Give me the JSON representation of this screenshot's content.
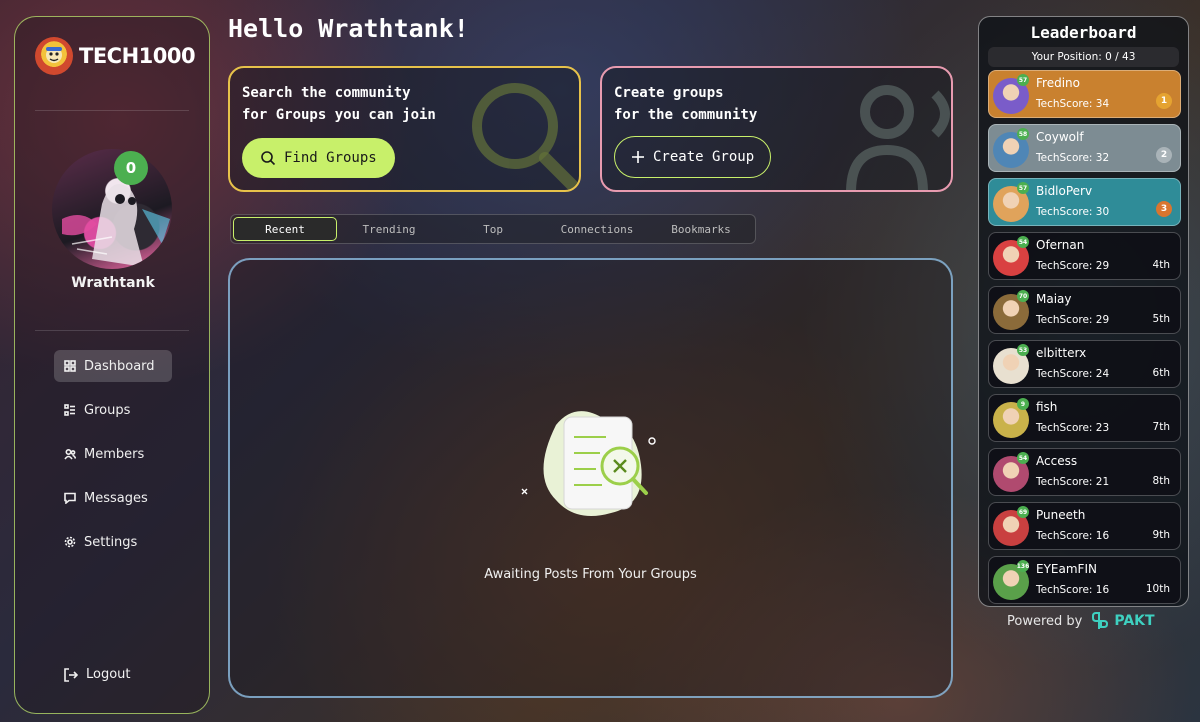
{
  "brand": {
    "name": "TECH1000"
  },
  "user": {
    "name": "Wrathtank",
    "level": "0"
  },
  "greeting": "Hello Wrathtank!",
  "nav": {
    "items": [
      {
        "label": "Dashboard",
        "icon": "dashboard-icon",
        "active": true
      },
      {
        "label": "Groups",
        "icon": "groups-icon"
      },
      {
        "label": "Members",
        "icon": "members-icon"
      },
      {
        "label": "Messages",
        "icon": "messages-icon"
      },
      {
        "label": "Settings",
        "icon": "settings-icon"
      }
    ],
    "logout": "Logout"
  },
  "cards": {
    "search": {
      "text": "Search the community\nfor Groups you can join",
      "button": "Find Groups",
      "color": "#e7c24a"
    },
    "create": {
      "text": "Create groups\nfor the community",
      "button": "Create Group",
      "color": "#e89bb0"
    }
  },
  "tabs": [
    "Recent",
    "Trending",
    "Top",
    "Connections",
    "Bookmarks"
  ],
  "feed": {
    "empty_text": "Awaiting Posts From Your Groups"
  },
  "leaderboard": {
    "title": "Leaderboard",
    "position": "Your Position: 0 / 43",
    "score_label": "TechScore:",
    "entries": [
      {
        "name": "Fredino",
        "score": "TechScore: 34",
        "rank": "1",
        "level": "57",
        "bg": "#c9812f",
        "medal": "#e5a331"
      },
      {
        "name": "Coywolf",
        "score": "TechScore: 32",
        "rank": "2",
        "level": "58",
        "bg": "#7d8c93",
        "medal": "#a9b3b8"
      },
      {
        "name": "BidloPerv",
        "score": "TechScore: 30",
        "rank": "3",
        "level": "57",
        "bg": "#2f8c98",
        "medal": "#d9752f"
      },
      {
        "name": "Ofernan",
        "score": "TechScore: 29",
        "rank": "4th",
        "level": "54"
      },
      {
        "name": "Maiay",
        "score": "TechScore: 29",
        "rank": "5th",
        "level": "70"
      },
      {
        "name": "elbitterx",
        "score": "TechScore: 24",
        "rank": "6th",
        "level": "53"
      },
      {
        "name": "fish",
        "score": "TechScore: 23",
        "rank": "7th",
        "level": "9"
      },
      {
        "name": "Access",
        "score": "TechScore: 21",
        "rank": "8th",
        "level": "54"
      },
      {
        "name": "Puneeth",
        "score": "TechScore: 16",
        "rank": "9th",
        "level": "69"
      },
      {
        "name": "EYEamFIN",
        "score": "TechScore: 16",
        "rank": "10th",
        "level": "136"
      }
    ]
  },
  "footer": {
    "powered_by": "Powered by",
    "partner": "PAKT"
  }
}
